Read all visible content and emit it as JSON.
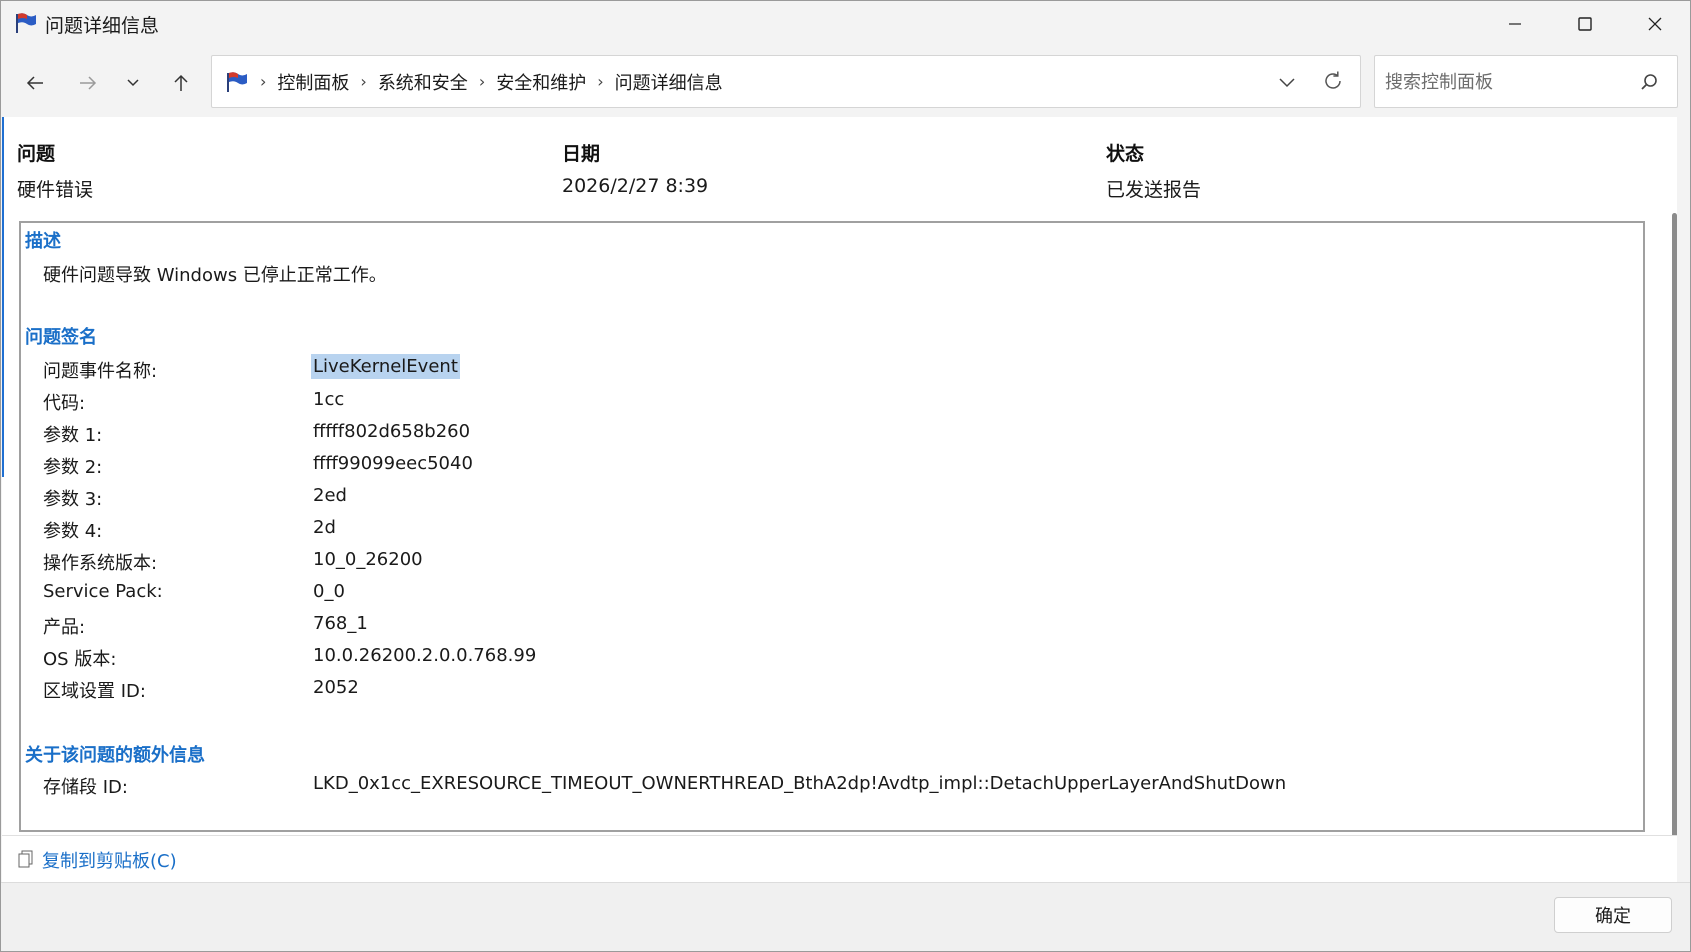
{
  "window": {
    "title": "问题详细信息"
  },
  "nav": {
    "breadcrumbs": [
      "控制面板",
      "系统和安全",
      "安全和维护",
      "问题详细信息"
    ],
    "separator": "›",
    "search_placeholder": "搜索控制面板"
  },
  "summary": {
    "problem_label": "问题",
    "problem_value": "硬件错误",
    "date_label": "日期",
    "date_value": "2026/2/27 8:39",
    "status_label": "状态",
    "status_value": "已发送报告"
  },
  "description": {
    "title": "描述",
    "text": "硬件问题导致 Windows 已停止正常工作。"
  },
  "signature": {
    "title": "问题签名",
    "rows": [
      {
        "key": "问题事件名称:",
        "value": "LiveKernelEvent"
      },
      {
        "key": "代码:",
        "value": "1cc"
      },
      {
        "key": "参数 1:",
        "value": "fffff802d658b260"
      },
      {
        "key": "参数 2:",
        "value": "ffff99099eec5040"
      },
      {
        "key": "参数 3:",
        "value": "2ed"
      },
      {
        "key": "参数 4:",
        "value": "2d"
      },
      {
        "key": "操作系统版本:",
        "value": "10_0_26200"
      },
      {
        "key": "Service Pack:",
        "value": "0_0"
      },
      {
        "key": "产品:",
        "value": "768_1"
      },
      {
        "key": "OS 版本:",
        "value": "10.0.26200.2.0.0.768.99"
      },
      {
        "key": "区域设置 ID:",
        "value": "2052"
      }
    ]
  },
  "extra": {
    "title": "关于该问题的额外信息",
    "rows": [
      {
        "key": "存储段 ID:",
        "value": "LKD_0x1cc_EXRESOURCE_TIMEOUT_OWNERTHREAD_BthA2dp!Avdtp_impl::DetachUpperLayerAndShutDown"
      }
    ]
  },
  "footer": {
    "copy_label": "复制到剪贴板(C)",
    "ok_label": "确定"
  },
  "colors": {
    "accent": "#1a6fc8",
    "selection": "#b8d3ef"
  }
}
